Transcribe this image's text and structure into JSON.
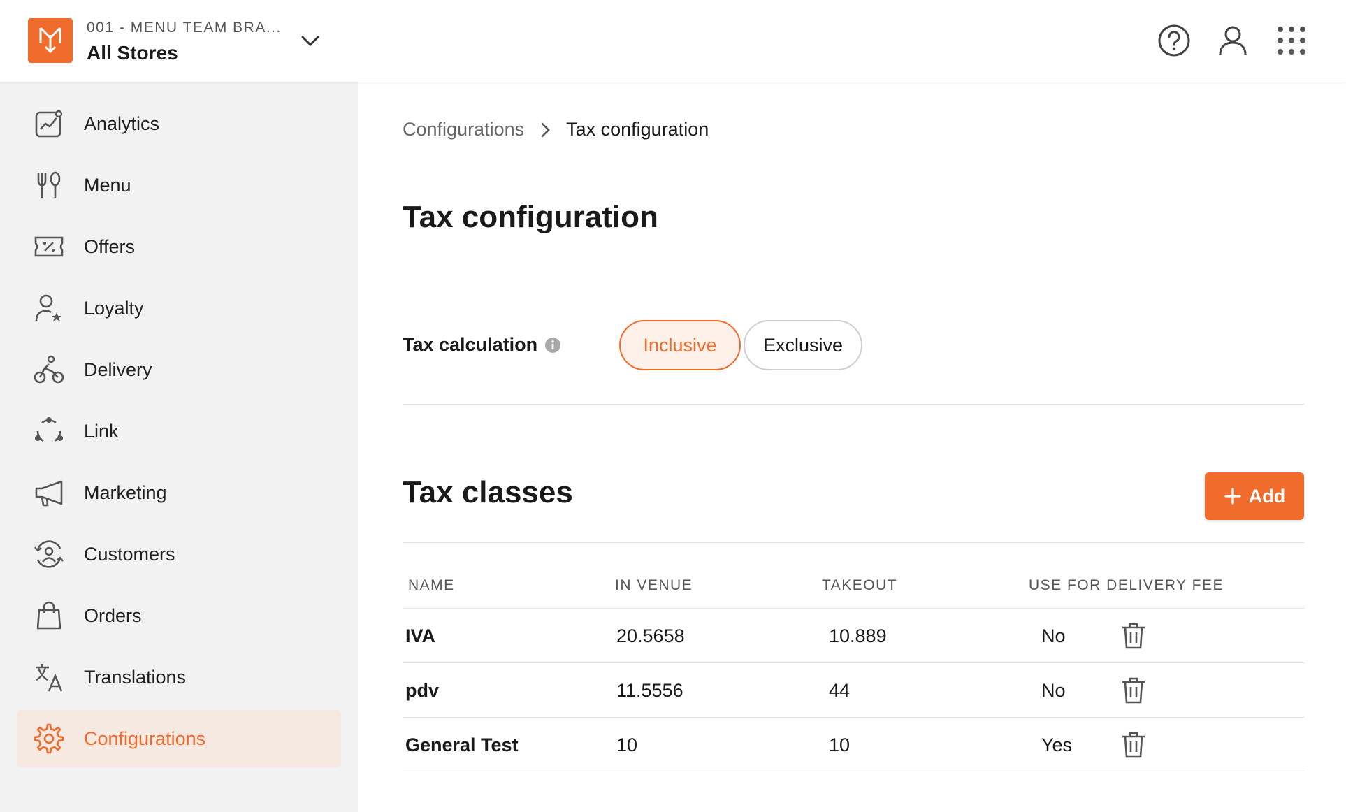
{
  "header": {
    "org_code": "001 - MENU TEAM BRA...",
    "store_selector": "All Stores",
    "icons": [
      "help-icon",
      "user-icon",
      "apps-grid-icon"
    ]
  },
  "sidebar": {
    "items": [
      {
        "label": "Analytics",
        "icon": "analytics-icon"
      },
      {
        "label": "Menu",
        "icon": "cutlery-icon"
      },
      {
        "label": "Offers",
        "icon": "ticket-icon"
      },
      {
        "label": "Loyalty",
        "icon": "loyalty-user-icon"
      },
      {
        "label": "Delivery",
        "icon": "bicycle-icon"
      },
      {
        "label": "Link",
        "icon": "link-nodes-icon"
      },
      {
        "label": "Marketing",
        "icon": "megaphone-icon"
      },
      {
        "label": "Customers",
        "icon": "customers-icon"
      },
      {
        "label": "Orders",
        "icon": "shopping-bag-icon"
      },
      {
        "label": "Translations",
        "icon": "translate-icon"
      },
      {
        "label": "Configurations",
        "icon": "gear-icon",
        "active": true
      }
    ]
  },
  "breadcrumb": {
    "parent": "Configurations",
    "current": "Tax configuration"
  },
  "page_title": "Tax configuration",
  "tax_calculation": {
    "label": "Tax calculation",
    "options": [
      "Inclusive",
      "Exclusive"
    ],
    "selected": "Inclusive"
  },
  "tax_classes": {
    "title": "Tax classes",
    "add_label": "Add",
    "columns": [
      "NAME",
      "IN VENUE",
      "TAKEOUT",
      "USE FOR DELIVERY FEE"
    ],
    "rows": [
      {
        "name": "IVA",
        "in_venue": "20.5658",
        "takeout": "10.889",
        "delivery_fee": "No"
      },
      {
        "name": "pdv",
        "in_venue": "11.5556",
        "takeout": "44",
        "delivery_fee": "No"
      },
      {
        "name": "General Test",
        "in_venue": "10",
        "takeout": "10",
        "delivery_fee": "Yes"
      }
    ]
  },
  "colors": {
    "accent": "#ef6c2c",
    "sidebar_bg": "#f2f2f2",
    "active_item_bg": "#f5e9e1"
  }
}
